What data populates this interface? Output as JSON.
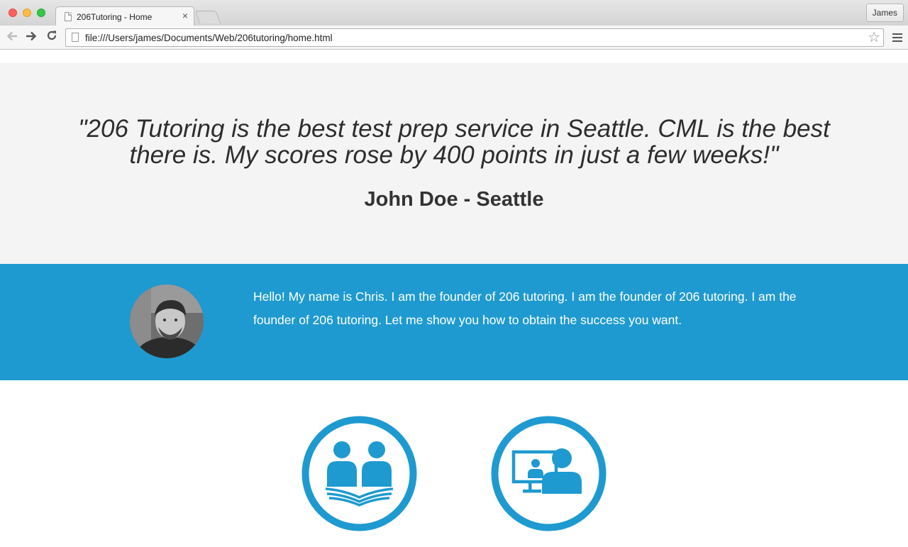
{
  "browser": {
    "tab_title": "206Tutoring - Home",
    "profile_name": "James",
    "url": "file:///Users/james/Documents/Web/206tutoring/home.html"
  },
  "testimonial": {
    "quote": "\"206 Tutoring is the best test prep service in Seattle. CML is the best there is. My scores rose by 400 points in just a few weeks!\"",
    "author": "John Doe - Seattle"
  },
  "founder": {
    "intro": "Hello! My name is Chris. I am the founder of 206 tutoring. I am the founder of 206 tutoring. I am the founder of 206 tutoring. Let me show you how to obtain the success you want."
  },
  "services": {
    "icons": [
      "group-study-icon",
      "online-tutoring-icon"
    ]
  },
  "colors": {
    "accent": "#1e9ad0",
    "testimonial_bg": "#f4f4f4",
    "text_dark": "#2d2d2d"
  }
}
